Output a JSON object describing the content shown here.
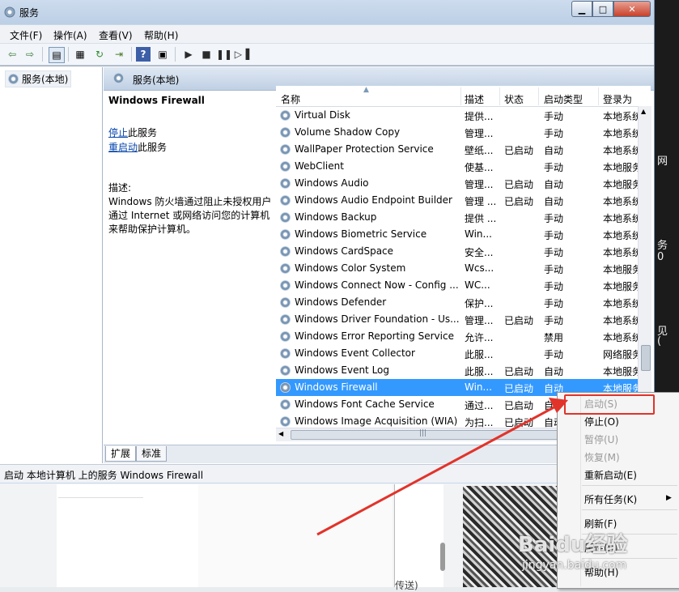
{
  "window": {
    "title": "服务"
  },
  "menu": [
    "文件(F)",
    "操作(A)",
    "查看(V)",
    "帮助(H)"
  ],
  "toolbar_icons": [
    "back-arrow-icon",
    "forward-arrow-icon",
    "show-hide-tree-icon",
    "properties-icon",
    "refresh-icon",
    "export-list-icon",
    "help-icon",
    "view-icon",
    "play-icon",
    "stop-icon",
    "pause-icon",
    "restart-icon"
  ],
  "tree": {
    "item": "服务(本地)"
  },
  "pane": {
    "header": "服务(本地)",
    "selected_title": "Windows Firewall",
    "stop_link": "停止",
    "stop_suffix": "此服务",
    "restart_link": "重启动",
    "restart_suffix": "此服务",
    "desc_label": "描述:",
    "desc_lines": [
      "Windows 防火墙通过阻止未授权用户",
      "通过 Internet 或网络访问您的计算机",
      "来帮助保护计算机。"
    ]
  },
  "columns": {
    "name": "名称",
    "desc": "描述",
    "status": "状态",
    "startup": "启动类型",
    "logon": "登录为"
  },
  "rows": [
    {
      "name": "Virtual Disk",
      "desc": "提供...",
      "status": "",
      "startup": "手动",
      "logon": "本地系统"
    },
    {
      "name": "Volume Shadow Copy",
      "desc": "管理...",
      "status": "",
      "startup": "手动",
      "logon": "本地系统"
    },
    {
      "name": "WallPaper Protection Service",
      "desc": "壁纸...",
      "status": "已启动",
      "startup": "自动",
      "logon": "本地系统"
    },
    {
      "name": "WebClient",
      "desc": "使基...",
      "status": "",
      "startup": "手动",
      "logon": "本地服务"
    },
    {
      "name": "Windows Audio",
      "desc": "管理...",
      "status": "已启动",
      "startup": "自动",
      "logon": "本地服务"
    },
    {
      "name": "Windows Audio Endpoint Builder",
      "desc": "管理 ...",
      "status": "已启动",
      "startup": "自动",
      "logon": "本地系统"
    },
    {
      "name": "Windows Backup",
      "desc": "提供 ...",
      "status": "",
      "startup": "手动",
      "logon": "本地系统"
    },
    {
      "name": "Windows Biometric Service",
      "desc": "Win...",
      "status": "",
      "startup": "手动",
      "logon": "本地系统"
    },
    {
      "name": "Windows CardSpace",
      "desc": "安全...",
      "status": "",
      "startup": "手动",
      "logon": "本地系统"
    },
    {
      "name": "Windows Color System",
      "desc": "Wcs...",
      "status": "",
      "startup": "手动",
      "logon": "本地服务"
    },
    {
      "name": "Windows Connect Now - Config ...",
      "desc": "WC...",
      "status": "",
      "startup": "手动",
      "logon": "本地服务"
    },
    {
      "name": "Windows Defender",
      "desc": "保护...",
      "status": "",
      "startup": "手动",
      "logon": "本地系统"
    },
    {
      "name": "Windows Driver Foundation - Us...",
      "desc": "管理...",
      "status": "已启动",
      "startup": "手动",
      "logon": "本地系统"
    },
    {
      "name": "Windows Error Reporting Service",
      "desc": "允许...",
      "status": "",
      "startup": "禁用",
      "logon": "本地系统"
    },
    {
      "name": "Windows Event Collector",
      "desc": "此服...",
      "status": "",
      "startup": "手动",
      "logon": "网络服务"
    },
    {
      "name": "Windows Event Log",
      "desc": "此服...",
      "status": "已启动",
      "startup": "自动",
      "logon": "本地服务"
    },
    {
      "name": "Windows Firewall",
      "desc": "Win...",
      "status": "已启动",
      "startup": "自动",
      "logon": "本地服务"
    },
    {
      "name": "Windows Font Cache Service",
      "desc": "通过...",
      "status": "已启动",
      "startup": "自动",
      "logon": "本地服务"
    },
    {
      "name": "Windows Image Acquisition (WIA)",
      "desc": "为扫...",
      "status": "已启动",
      "startup": "自动",
      "logon": "本地服务"
    }
  ],
  "tabs": [
    "扩展",
    "标准"
  ],
  "status": "启动 本地计算机 上的服务 Windows Firewall",
  "context_menu": {
    "start": "启动(S)",
    "stop": "停止(O)",
    "pause": "暂停(U)",
    "resume": "恢复(M)",
    "restart": "重新启动(E)",
    "all_tasks": "所有任务(K)",
    "refresh": "刷新(F)",
    "properties": "属性(R)",
    "help": "帮助(H)"
  },
  "background": {
    "right_chars": [
      "网",
      "务",
      "0",
      "见",
      "("
    ],
    "bottom_text": "传送)"
  },
  "watermark": {
    "logo": "Baidu经验",
    "url": "jingyan.baidu.com"
  },
  "colors": {
    "selection": "#3399ff",
    "annotation": "#e2332a",
    "link": "#0645ad"
  }
}
